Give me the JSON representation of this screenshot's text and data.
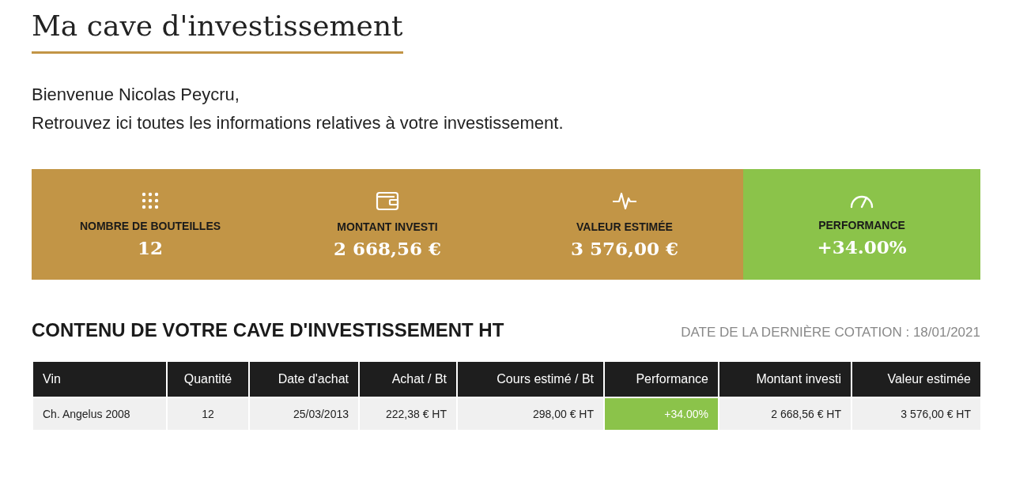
{
  "page_title": "Ma cave d'investissement",
  "welcome": [
    "Bienvenue Nicolas Peycru,",
    "Retrouvez ici toutes les informations relatives à votre investissement."
  ],
  "stats": [
    {
      "kind": "bottles",
      "label": "NOMBRE DE BOUTEILLES",
      "value": "12",
      "highlight": false
    },
    {
      "kind": "wallet",
      "label": "MONTANT INVESTI",
      "value": "2 668,56 €",
      "highlight": false
    },
    {
      "kind": "pulse",
      "label": "VALEUR ESTIMÉE",
      "value": "3 576,00 €",
      "highlight": false
    },
    {
      "kind": "gauge",
      "label": "PERFORMANCE",
      "value": "+34.00%",
      "highlight": true
    }
  ],
  "section_title": "CONTENU DE VOTRE CAVE D'INVESTISSEMENT HT",
  "quote_date": "DATE DE LA DERNIÈRE COTATION : 18/01/2021",
  "table": {
    "columns": [
      "Vin",
      "Quantité",
      "Date d'achat",
      "Achat / Bt",
      "Cours estimé / Bt",
      "Performance",
      "Montant investi",
      "Valeur estimée"
    ],
    "rows": [
      {
        "cells": [
          {
            "text": "Ch. Angelus 2008",
            "highlight": false
          },
          {
            "text": "12",
            "highlight": false
          },
          {
            "text": "25/03/2013",
            "highlight": false
          },
          {
            "text": "222,38 € HT",
            "highlight": false
          },
          {
            "text": "298,00 € HT",
            "highlight": false
          },
          {
            "text": "+34.00%",
            "highlight": true
          },
          {
            "text": "2 668,56 € HT",
            "highlight": false
          },
          {
            "text": "3 576,00 € HT",
            "highlight": false
          }
        ]
      }
    ]
  }
}
